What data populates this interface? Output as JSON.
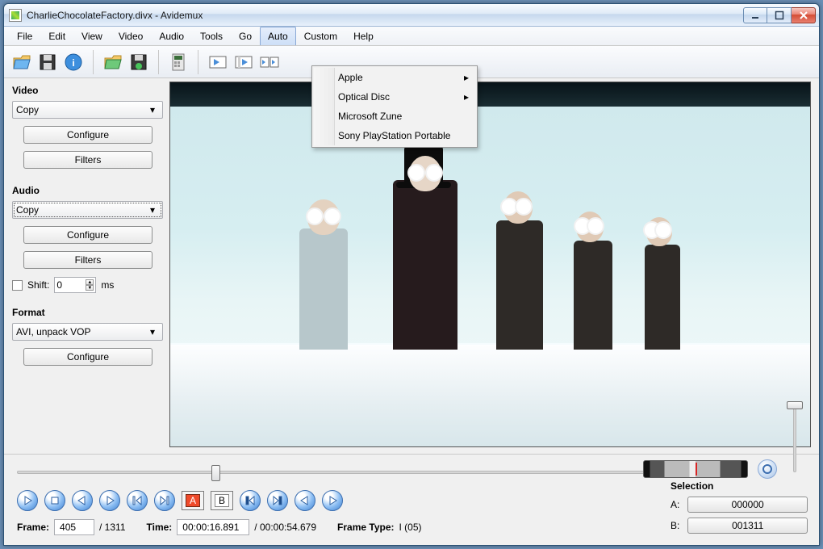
{
  "window": {
    "title": "CharlieChocolateFactory.divx - Avidemux"
  },
  "menu": {
    "items": [
      "File",
      "Edit",
      "View",
      "Video",
      "Audio",
      "Tools",
      "Go",
      "Auto",
      "Custom",
      "Help"
    ],
    "active_index": 7,
    "dropdown": {
      "items": [
        {
          "label": "Apple",
          "has_submenu": true
        },
        {
          "label": "Optical Disc",
          "has_submenu": true
        },
        {
          "label": "Microsoft Zune",
          "has_submenu": false
        },
        {
          "label": "Sony PlayStation Portable",
          "has_submenu": false
        }
      ]
    }
  },
  "left": {
    "video": {
      "heading": "Video",
      "codec": "Copy",
      "configure": "Configure",
      "filters": "Filters"
    },
    "audio": {
      "heading": "Audio",
      "codec": "Copy",
      "configure": "Configure",
      "filters": "Filters",
      "shift_label": "Shift:",
      "shift_value": "0",
      "shift_unit": "ms"
    },
    "format": {
      "heading": "Format",
      "container": "AVI, unpack VOP",
      "configure": "Configure"
    }
  },
  "status": {
    "frame_label": "Frame:",
    "frame_value": "405",
    "frame_total": "/ 1311",
    "time_label": "Time:",
    "time_value": "00:00:16.891",
    "time_total": "/ 00:00:54.679",
    "frametype_label": "Frame Type:",
    "frametype_value": "I (05)"
  },
  "selection": {
    "heading": "Selection",
    "a_label": "A:",
    "a_value": "000000",
    "b_label": "B:",
    "b_value": "001311"
  },
  "slider": {
    "position_pct": 30.9
  }
}
